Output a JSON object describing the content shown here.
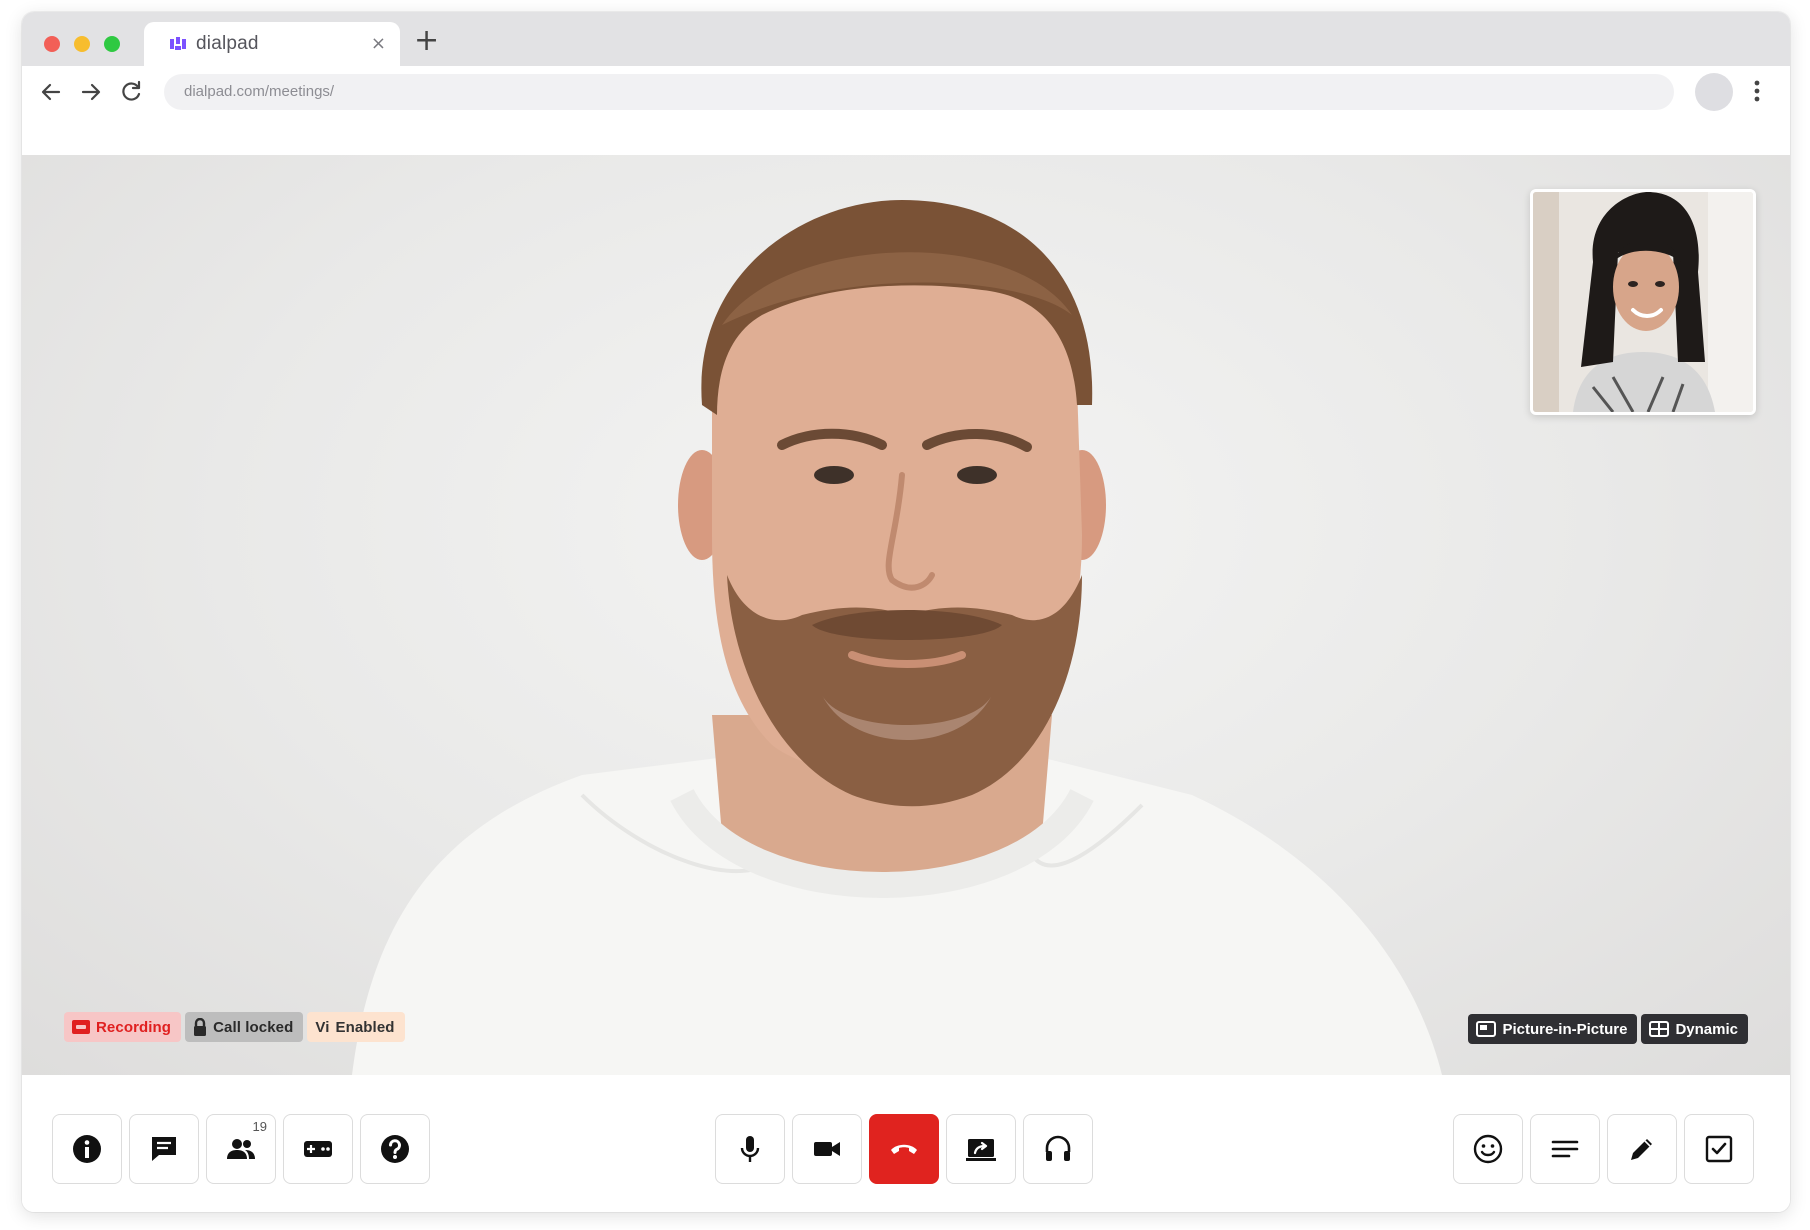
{
  "browser": {
    "tab_title": "dialpad",
    "url": "dialpad.com/meetings/"
  },
  "status_badges": {
    "recording": "Recording",
    "call_locked": "Call locked",
    "vi_icon_text": "Vi",
    "vi_enabled": "Enabled"
  },
  "view_options": {
    "picture_in_picture": "Picture-in-Picture",
    "dynamic": "Dynamic"
  },
  "controls": {
    "participants_count": "19",
    "left": [
      "info-icon",
      "chat-icon",
      "participants-icon",
      "keypad-icon",
      "help-icon"
    ],
    "center": [
      "microphone-icon",
      "camera-icon",
      "hang-up-icon",
      "screen-share-icon",
      "headset-icon"
    ],
    "right": [
      "emoji-icon",
      "notes-icon",
      "pen-icon",
      "checklist-icon"
    ]
  },
  "colors": {
    "hang_up": "#e0231f",
    "recording_text": "#e02020",
    "recording_bg": "#f7c6c6",
    "dialpad_purple": "#7c52ff",
    "dark_toggle_bg": "#2f2f33"
  }
}
